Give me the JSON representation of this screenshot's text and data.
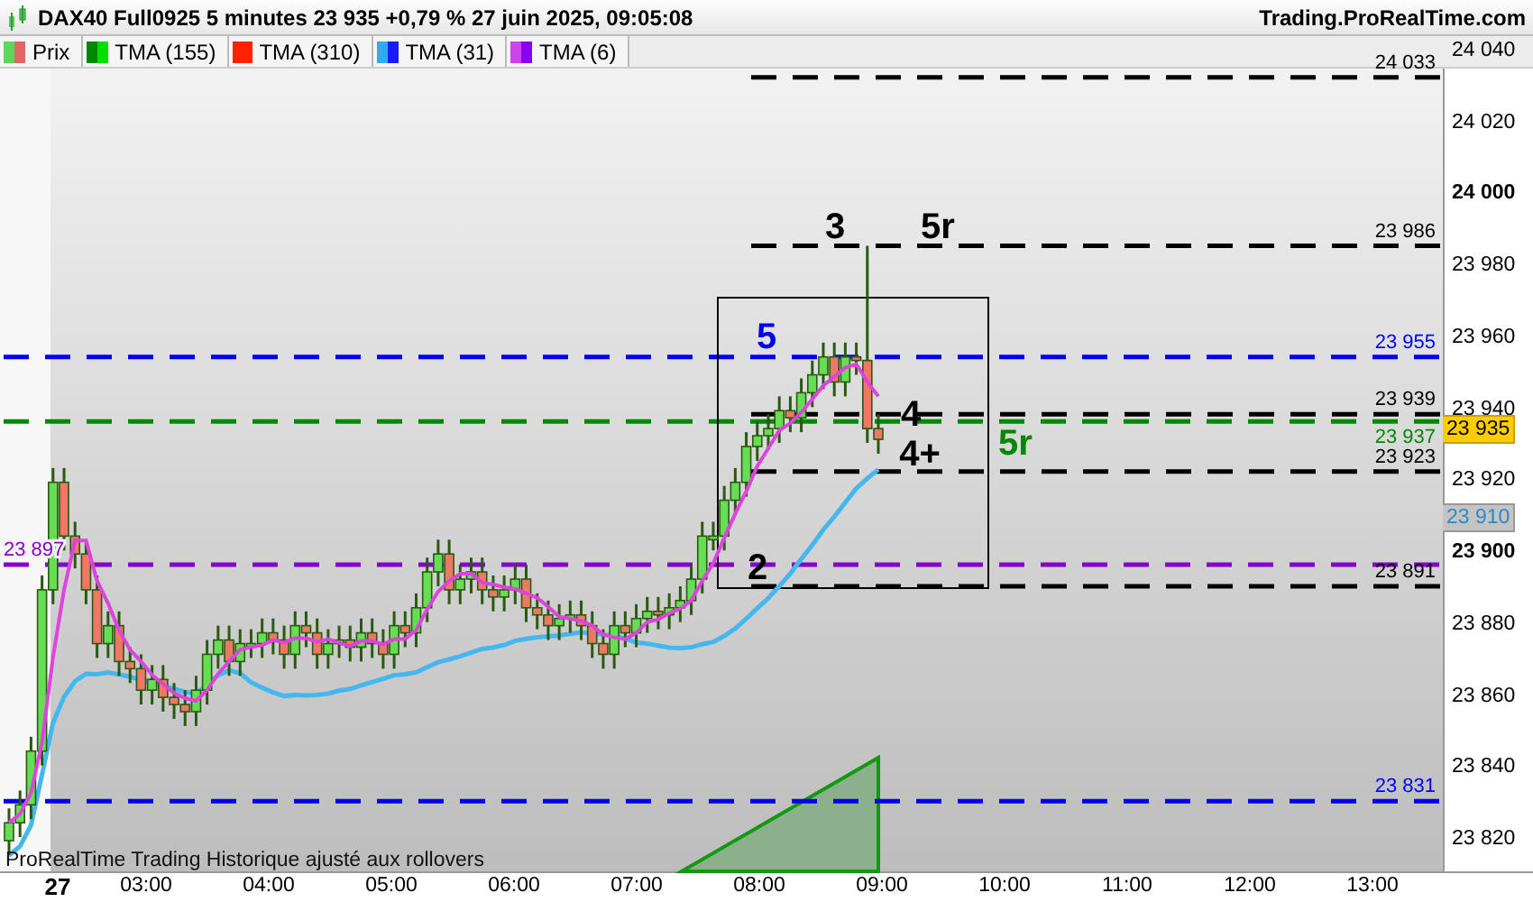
{
  "header": {
    "title": "DAX40 Full0925 5 minutes 23 935 +0,79 % 27 juin 2025, 09:05:08",
    "site": "Trading.ProRealTime.com"
  },
  "legend": [
    {
      "label": "Prix",
      "swatches": [
        {
          "color": "#5cd65c"
        },
        {
          "color": "#e06666"
        }
      ]
    },
    {
      "label": "TMA (155)",
      "swatches": [
        {
          "color": "#008800"
        },
        {
          "color": "#00e000"
        }
      ]
    },
    {
      "label": "TMA (310)",
      "swatches": [
        {
          "color": "#ff2200"
        }
      ]
    },
    {
      "label": "TMA (31)",
      "swatches": [
        {
          "color": "#33aaee"
        },
        {
          "color": "#1a1aff"
        }
      ]
    },
    {
      "label": "TMA (6)",
      "swatches": [
        {
          "color": "#cc44ee"
        },
        {
          "color": "#8800ee"
        }
      ]
    }
  ],
  "chart": {
    "levels": [
      {
        "kind": "partial",
        "label": "24 033",
        "color": "#000000"
      },
      {
        "kind": "partial",
        "label": "23 986",
        "color": "#000000"
      },
      {
        "kind": "full",
        "label": "23 955",
        "color": "#0000ee"
      },
      {
        "kind": "partial",
        "label": "23 939",
        "color": "#000000"
      },
      {
        "kind": "full-label-below",
        "label": "23 937",
        "color": "#008800"
      },
      {
        "kind": "partial",
        "label": "23 923",
        "color": "#000000"
      },
      {
        "kind": "full-left-label",
        "label": "23 897",
        "color": "#8800cc"
      },
      {
        "kind": "partial",
        "label": "23 891",
        "color": "#000000"
      },
      {
        "kind": "full",
        "label": "23 831",
        "color": "#0000ee"
      }
    ],
    "annotations": [
      {
        "text": "3",
        "color": "#000000"
      },
      {
        "text": "5r",
        "color": "#000000"
      },
      {
        "text": "5",
        "color": "#0000ee"
      },
      {
        "text": "4",
        "color": "#000000"
      },
      {
        "text": "5r",
        "color": "#008800"
      },
      {
        "text": "4+",
        "color": "#000000"
      },
      {
        "text": "2",
        "color": "#000000"
      }
    ],
    "footnote": "ProRealTime Trading  Historique ajusté aux rollovers",
    "price_badges": [
      {
        "label": "23 935",
        "kind": "last"
      },
      {
        "label": "23 910",
        "kind": "indicator"
      }
    ],
    "yticks": [
      {
        "label": "24 040",
        "major": false
      },
      {
        "label": "24 020",
        "major": false
      },
      {
        "label": "24 000",
        "major": true
      },
      {
        "label": "23 980",
        "major": false
      },
      {
        "label": "23 960",
        "major": false
      },
      {
        "label": "23 940",
        "major": false
      },
      {
        "label": "23 920",
        "major": false
      },
      {
        "label": "23 900",
        "major": true
      },
      {
        "label": "23 880",
        "major": false
      },
      {
        "label": "23 860",
        "major": false
      },
      {
        "label": "23 840",
        "major": false
      },
      {
        "label": "23 820",
        "major": false
      }
    ],
    "xticks": [
      {
        "label": "27",
        "major": true
      },
      {
        "label": "03:00",
        "major": false
      },
      {
        "label": "04:00",
        "major": false
      },
      {
        "label": "05:00",
        "major": false
      },
      {
        "label": "06:00",
        "major": false
      },
      {
        "label": "07:00",
        "major": false
      },
      {
        "label": "08:00",
        "major": false
      },
      {
        "label": "09:00",
        "major": false
      },
      {
        "label": "10:00",
        "major": false
      },
      {
        "label": "11:00",
        "major": false
      },
      {
        "label": "12:00",
        "major": false
      },
      {
        "label": "13:00",
        "major": false
      }
    ]
  }
}
